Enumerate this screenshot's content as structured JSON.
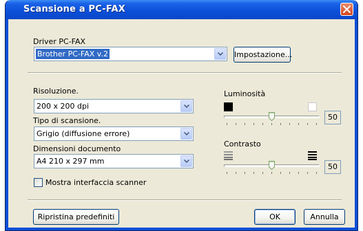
{
  "window": {
    "title": "Scansione a PC-FAX",
    "close_icon": "close-icon"
  },
  "driver": {
    "label": "Driver PC-FAX",
    "value": "Brother PC-FAX v.2",
    "setup_button": "Impostazione..."
  },
  "resolution": {
    "label": "Risoluzione.",
    "value": "200 x 200 dpi"
  },
  "scan_type": {
    "label": "Tipo di scansione.",
    "value": "Grigio (diffusione errore)"
  },
  "document_size": {
    "label": "Dimensioni documento",
    "value": "A4 210 x 297 mm"
  },
  "show_scanner_interface": {
    "label": "Mostra interfaccia scanner",
    "checked": false
  },
  "brightness": {
    "label": "Luminosità",
    "value": "50",
    "level": 0.5,
    "low_icon": "dark-swatch-icon",
    "high_icon": "light-swatch-icon"
  },
  "contrast": {
    "label": "Contrasto",
    "value": "50",
    "level": 0.5,
    "low_icon": "low-contrast-icon",
    "high_icon": "high-contrast-icon"
  },
  "footer": {
    "restore_defaults": "Ripristina predefiniti",
    "ok": "OK",
    "cancel": "Annulla"
  },
  "colors": {
    "title_bar": "#0b4fd8",
    "dialog_bg": "#ece9d8",
    "selection": "#316ac5",
    "close_button": "#d5431b"
  }
}
